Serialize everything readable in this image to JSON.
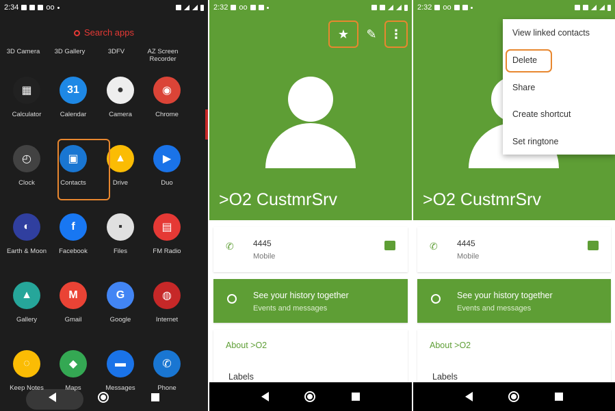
{
  "screen1": {
    "status": {
      "time": "2:34",
      "indicator": "oo"
    },
    "search_placeholder": "Search apps",
    "top_row": [
      "3D Camera",
      "3D Gallery",
      "3DFV",
      "AZ Screen Recorder"
    ],
    "apps": [
      {
        "label": "Calculator",
        "color": "#212121",
        "glyph": "▦"
      },
      {
        "label": "Calendar",
        "color": "#1e88e5",
        "glyph": "31"
      },
      {
        "label": "Camera",
        "color": "#eeeeee",
        "glyph": "●"
      },
      {
        "label": "Chrome",
        "color": "#db4437",
        "glyph": "◉"
      },
      {
        "label": "Clock",
        "color": "#424242",
        "glyph": "◴"
      },
      {
        "label": "Contacts",
        "color": "#1976d2",
        "glyph": "▣"
      },
      {
        "label": "Drive",
        "color": "#fbbc04",
        "glyph": "▲"
      },
      {
        "label": "Duo",
        "color": "#1a73e8",
        "glyph": "▶"
      },
      {
        "label": "Earth & Moon",
        "color": "#303f9f",
        "glyph": "◐"
      },
      {
        "label": "Facebook",
        "color": "#1877f2",
        "glyph": "f"
      },
      {
        "label": "Files",
        "color": "#e0e0e0",
        "glyph": "▪"
      },
      {
        "label": "FM Radio",
        "color": "#e53935",
        "glyph": "▤"
      },
      {
        "label": "Gallery",
        "color": "#26a69a",
        "glyph": "▲"
      },
      {
        "label": "Gmail",
        "color": "#ea4335",
        "glyph": "M"
      },
      {
        "label": "Google",
        "color": "#4285f4",
        "glyph": "G"
      },
      {
        "label": "Internet",
        "color": "#c62828",
        "glyph": "◍"
      },
      {
        "label": "Keep Notes",
        "color": "#fbbc04",
        "glyph": "◌"
      },
      {
        "label": "Maps",
        "color": "#34a853",
        "glyph": "◆"
      },
      {
        "label": "Messages",
        "color": "#1a73e8",
        "glyph": "▬"
      },
      {
        "label": "Phone",
        "color": "#1976d2",
        "glyph": "✆"
      }
    ]
  },
  "screen2": {
    "status": {
      "time": "2:32",
      "indicator": "oo"
    },
    "contact_name": ">O2 CustmrSrv",
    "phone": {
      "number": "4445",
      "type": "Mobile"
    },
    "history": {
      "title": "See your history together",
      "subtitle": "Events and messages"
    },
    "about": "About >O2",
    "labels": "Labels"
  },
  "screen3": {
    "status": {
      "time": "2:32",
      "indicator": "oo"
    },
    "contact_name": ">O2 CustmrSrv",
    "phone": {
      "number": "4445",
      "type": "Mobile"
    },
    "history": {
      "title": "See your history together",
      "subtitle": "Events and messages"
    },
    "about": "About >O2",
    "labels": "Labels",
    "menu": [
      "View linked contacts",
      "Delete",
      "Share",
      "Create shortcut",
      "Set ringtone"
    ]
  },
  "accent_color": "#5e9e35",
  "highlight_color": "#e8872f"
}
